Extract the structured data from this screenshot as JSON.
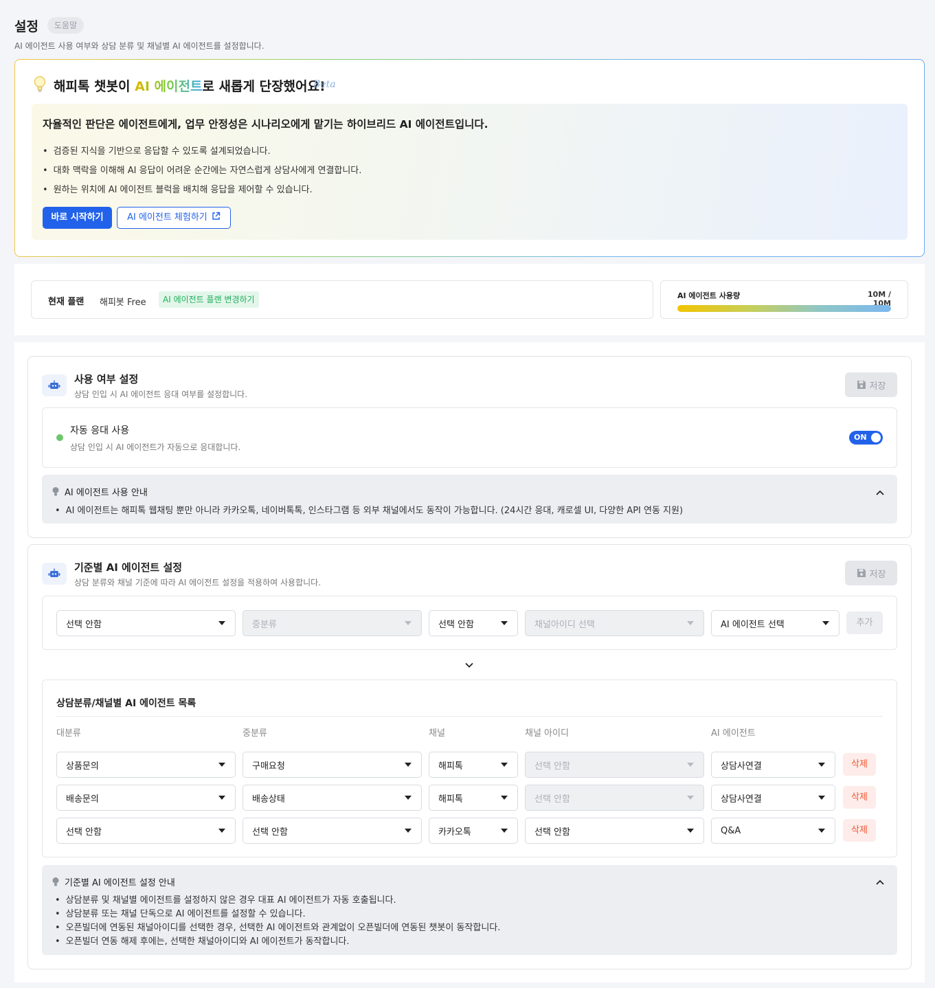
{
  "header": {
    "title": "설정",
    "help_label": "도움말",
    "description": "AI 에이전트 사용 여부와 상담 분류 및 채널별 AI 에이전트를 설정합니다."
  },
  "promo": {
    "title_prefix": "해피톡 챗봇이 ",
    "title_highlight": "AI 에이전트",
    "title_suffix": "로 새롭게 단장했어요!",
    "beta_label": "Beta",
    "lead": "자율적인 판단은 에이전트에게, 업무 안정성은 시나리오에게 맡기는 하이브리드 AI 에이전트입니다.",
    "bullets": [
      "검증된 지식을 기반으로 응답할 수 있도록 설계되었습니다.",
      "대화 맥락을 이해해 AI 응답이 어려운 순간에는 자연스럽게 상담사에게 연결합니다.",
      "원하는 위치에 AI 에이전트 블럭을 배치해 응답을 제어할 수 있습니다."
    ],
    "start_button": "바로 시작하기",
    "try_button": "AI 에이전트 체험하기"
  },
  "plan": {
    "label": "현재 플랜",
    "name": "해피봇 Free",
    "change_link": "AI 에이전트 플랜 변경하기",
    "usage_label": "AI 에이전트 사용량",
    "usage_value": "10M / 10M",
    "usage_fraction": 1.0
  },
  "usage_section": {
    "title": "사용 여부 설정",
    "description": "상담 인입 시 AI 에이전트 응대 여부를 설정합니다.",
    "save_label": "저장",
    "auto_reply_title": "자동 응대 사용",
    "auto_reply_desc": "상담 인입 시 AI 에이전트가 자동으로 응대합니다.",
    "toggle_label": "ON",
    "info_title": "AI 에이전트 사용 안내",
    "info_items": [
      "AI 에이전트는 해피톡 웹채팅 뿐만 아니라 카카오톡, 네이버톡톡, 인스타그램 등 외부 채널에서도 동작이 가능합니다. (24시간 응대, 캐로셀 UI, 다양한 API 연동 지원)"
    ]
  },
  "criteria_section": {
    "title": "기준별 AI 에이전트 설정",
    "description": "상담 분류와 채널 기준에 따라 AI 에이전트 설정을 적용하여 사용합니다.",
    "save_label": "저장",
    "filters": {
      "major": "선택 안함",
      "minor": "중분류",
      "channel": "선택 안함",
      "channel_id": "채널아이디 선택",
      "agent": "AI 에이전트 선택",
      "add_label": "추가"
    },
    "list_title": "상담분류/채널별 AI 에이전트 목록",
    "columns": [
      "대분류",
      "중분류",
      "채널",
      "채널 아이디",
      "AI 에이전트"
    ],
    "delete_label": "삭제",
    "rows": [
      {
        "major": "상품문의",
        "minor": "구매요청",
        "channel": "해피톡",
        "channel_id": "선택 안함",
        "channel_id_disabled": true,
        "agent": "상담사연결"
      },
      {
        "major": "배송문의",
        "minor": "배송상태",
        "channel": "해피톡",
        "channel_id": "선택 안함",
        "channel_id_disabled": true,
        "agent": "상담사연결"
      },
      {
        "major": "선택 안함",
        "minor": "선택 안함",
        "channel": "카카오톡",
        "channel_id": "선택 안함",
        "channel_id_disabled": false,
        "agent": "Q&A"
      }
    ],
    "info_title": "기준별 AI 에이전트 설정 안내",
    "info_items": [
      "상담분류 및 채널별 에이전트를 설정하지 않은 경우 대표 AI 에이전트가 자동 호출됩니다.",
      "상담분류 또는 채널 단독으로 AI 에이전트를 설정할 수 있습니다.",
      "오픈빌더에 연동된 채널아이디를 선택한 경우, 선택한 AI 에이전트와 관계없이 오픈빌더에 연동된 챗봇이 동작합니다.",
      "오픈빌더 연동 해제 후에는, 선택한 채널아이디와 AI 에이전트가 동작합니다."
    ]
  }
}
